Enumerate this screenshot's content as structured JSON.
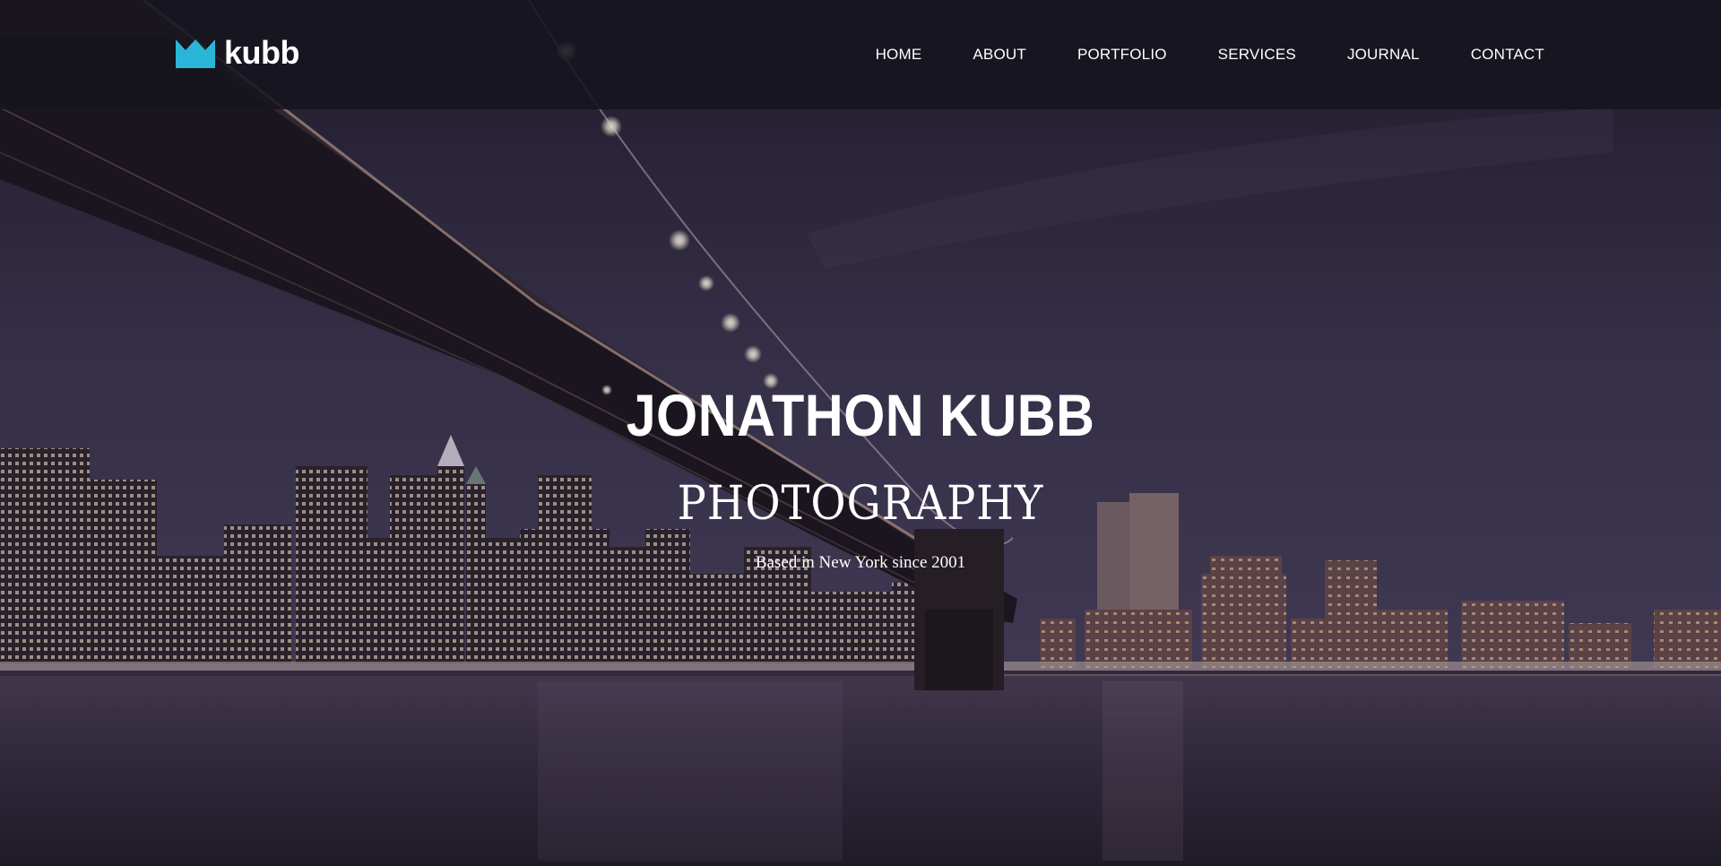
{
  "brand": {
    "logo_text": "kubb",
    "logo_icon": "crown-icon",
    "accent_color": "#29b6d8"
  },
  "nav": {
    "items": [
      {
        "label": "HOME"
      },
      {
        "label": "ABOUT"
      },
      {
        "label": "PORTFOLIO"
      },
      {
        "label": "SERVICES"
      },
      {
        "label": "JOURNAL"
      },
      {
        "label": "CONTACT"
      }
    ]
  },
  "hero": {
    "name": "JONATHON KUBB",
    "subtitle": "PHOTOGRAPHY",
    "tagline": "Based in New York since 2001"
  }
}
